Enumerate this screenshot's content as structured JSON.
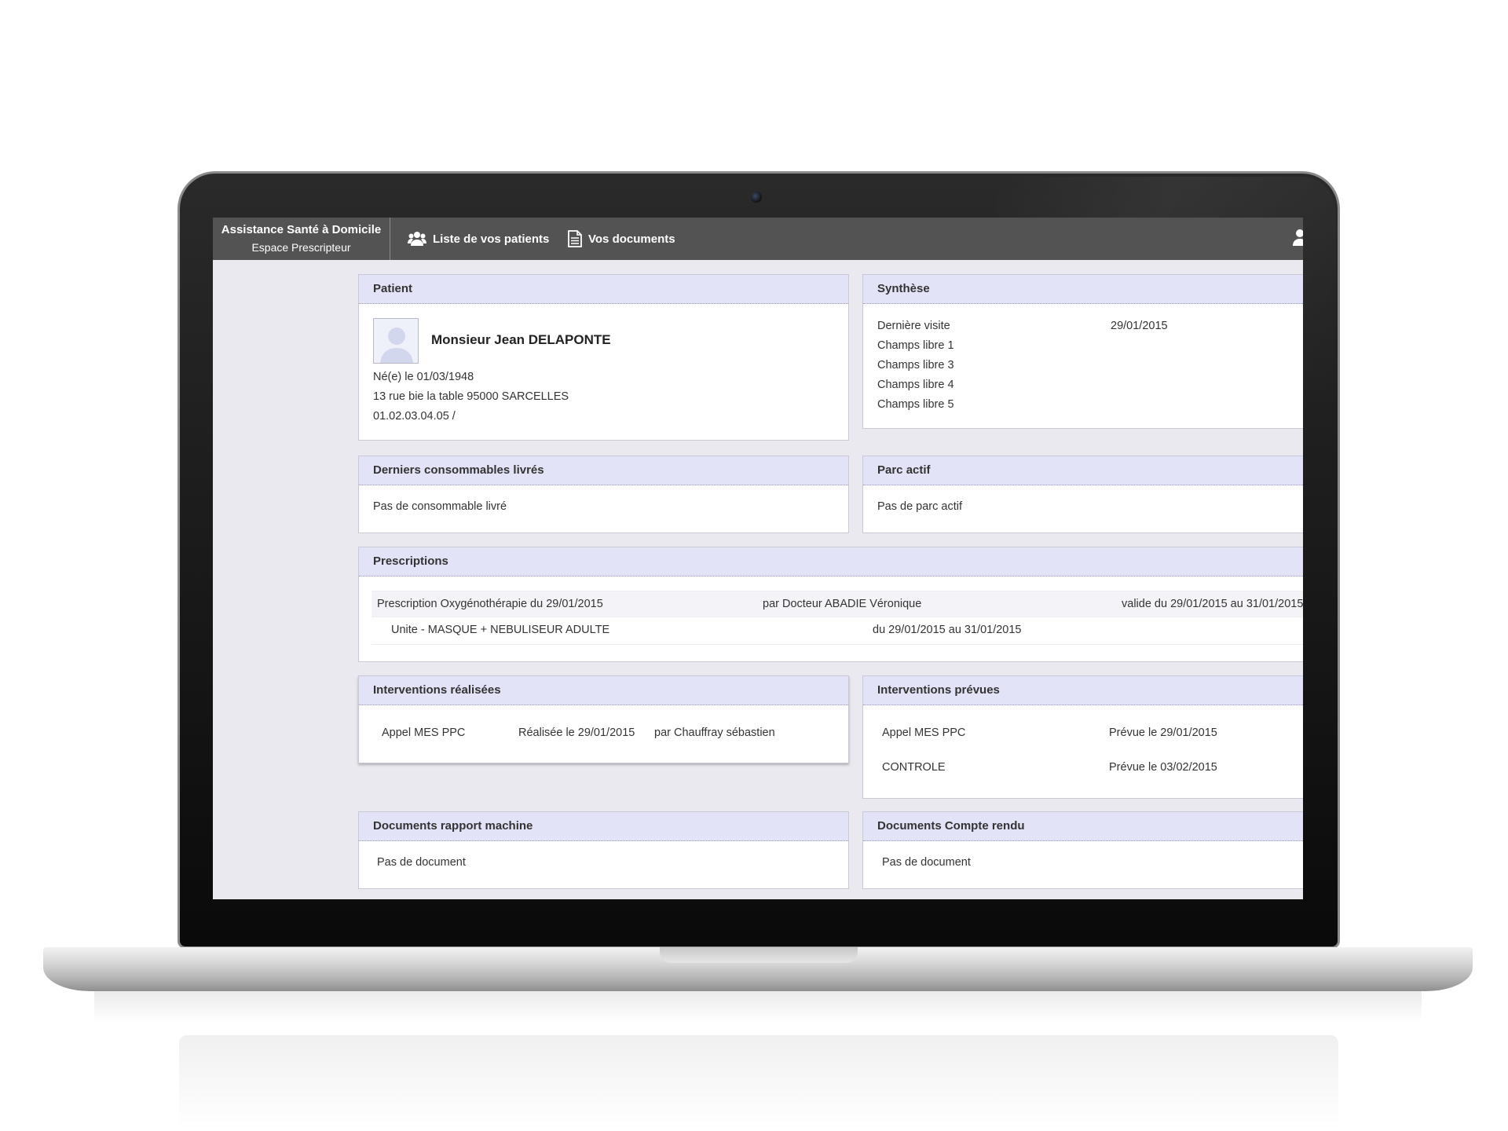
{
  "app": {
    "brand_title": "Assistance Santé à Domicile",
    "brand_subtitle": "Espace Prescripteur"
  },
  "nav": {
    "patients_label": "Liste de vos patients",
    "documents_label": "Vos documents"
  },
  "patient": {
    "header": "Patient",
    "name": "Monsieur Jean DELAPONTE",
    "birth": "Né(e) le 01/03/1948",
    "address": "13 rue bie la table 95000 SARCELLES",
    "phone": "01.02.03.04.05 /"
  },
  "synthese": {
    "header": "Synthèse",
    "rows": [
      {
        "label": "Dernière visite",
        "value": "29/01/2015"
      },
      {
        "label": "Champs libre 1",
        "value": ""
      },
      {
        "label": "Champs libre 3",
        "value": ""
      },
      {
        "label": "Champs libre 4",
        "value": ""
      },
      {
        "label": "Champs libre 5",
        "value": ""
      }
    ]
  },
  "consommables": {
    "header": "Derniers consommables livrés",
    "empty": "Pas de consommable livré"
  },
  "parc": {
    "header": "Parc actif",
    "empty": "Pas de parc actif"
  },
  "prescriptions": {
    "header": "Prescriptions",
    "main": {
      "title": "Prescription Oxygénothérapie du 29/01/2015",
      "doctor": "par Docteur ABADIE Véronique",
      "validity": "valide du 29/01/2015 au 31/01/2015"
    },
    "line": {
      "item": "Unite - MASQUE + NEBULISEUR ADULTE",
      "period": "du 29/01/2015 au 31/01/2015"
    }
  },
  "interventions_realisees": {
    "header": "Interventions réalisées",
    "rows": [
      {
        "type": "Appel MES PPC",
        "date": "Réalisée le 29/01/2015",
        "by": "par Chauffray sébastien"
      }
    ]
  },
  "interventions_prevues": {
    "header": "Interventions prévues",
    "rows": [
      {
        "type": "Appel MES PPC",
        "date": "Prévue le 29/01/2015"
      },
      {
        "type": "CONTROLE",
        "date": "Prévue le 03/02/2015"
      }
    ]
  },
  "docs_machine": {
    "header": "Documents rapport machine",
    "empty": "Pas de document"
  },
  "docs_compte_rendu": {
    "header": "Documents Compte rendu",
    "empty": "Pas de document"
  }
}
